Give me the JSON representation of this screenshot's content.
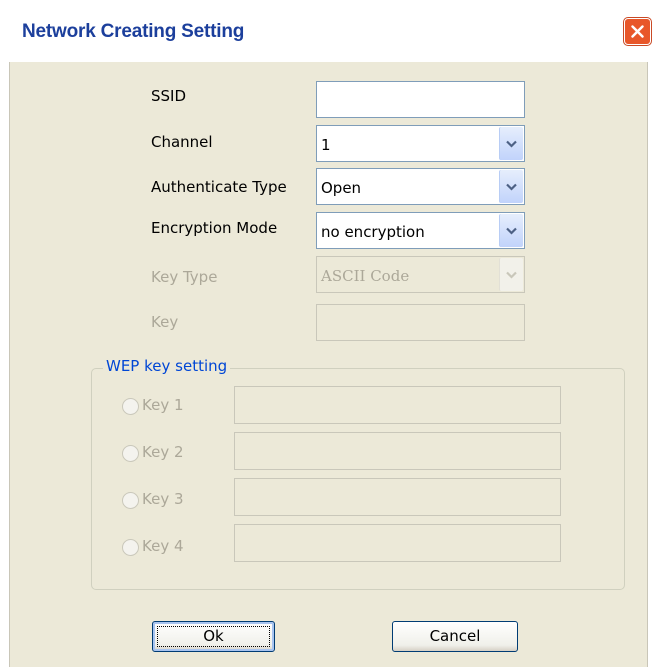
{
  "window": {
    "title": "Network Creating Setting"
  },
  "form": {
    "ssid": {
      "label": "SSID",
      "value": ""
    },
    "channel": {
      "label": "Channel",
      "value": "1"
    },
    "auth": {
      "label": "Authenticate Type",
      "value": "Open"
    },
    "encryption": {
      "label": "Encryption Mode",
      "value": "no encryption"
    },
    "key_type": {
      "label": "Key Type",
      "value": "ASCII Code",
      "disabled": true
    },
    "key": {
      "label": "Key",
      "value": "",
      "disabled": true
    }
  },
  "wep": {
    "title": "WEP key setting",
    "keys": [
      {
        "label": "Key 1",
        "value": ""
      },
      {
        "label": "Key 2",
        "value": ""
      },
      {
        "label": "Key 3",
        "value": ""
      },
      {
        "label": "Key 4",
        "value": ""
      }
    ]
  },
  "buttons": {
    "ok": "Ok",
    "cancel": "Cancel"
  },
  "icons": {
    "close": "close-icon",
    "dropdown": "chevron-down-icon"
  },
  "colors": {
    "title_text": "#1c3f9c",
    "close_button": "#e8572a",
    "dialog_bg": "#ece9d8",
    "group_title": "#0046d5",
    "disabled_text": "#aca899"
  }
}
